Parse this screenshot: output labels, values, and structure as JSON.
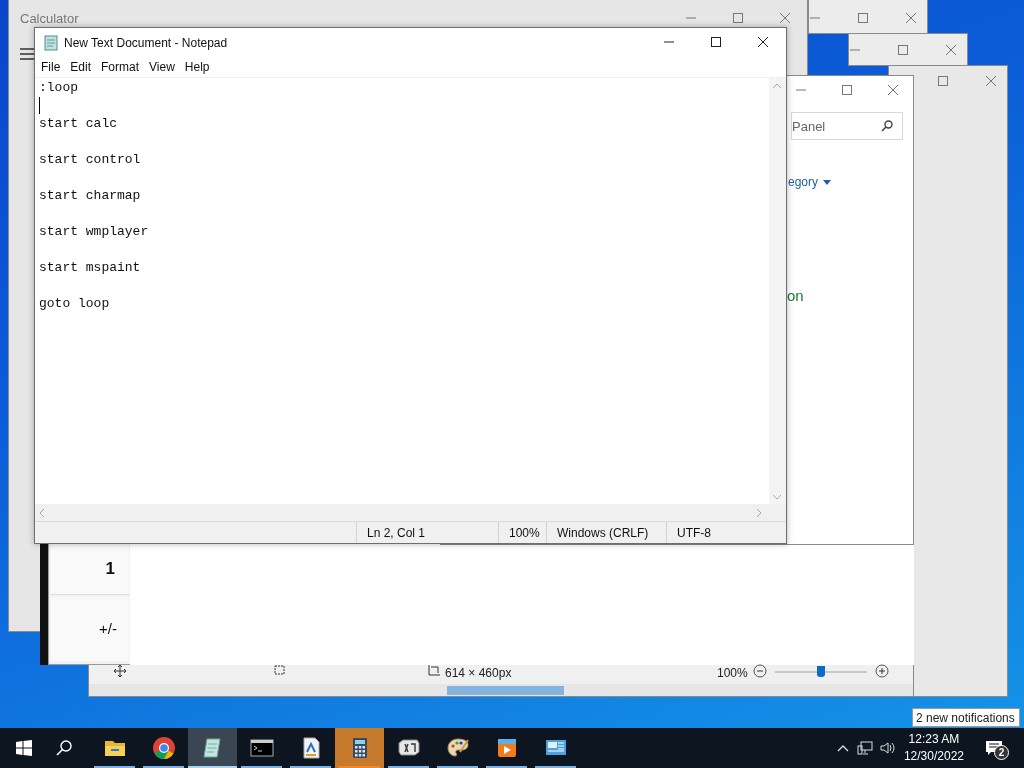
{
  "calculator": {
    "title": "Calculator",
    "keys": [
      "1",
      "+/-"
    ]
  },
  "control_panel": {
    "search": {
      "placeholder": "Panel"
    },
    "view_by": "egory",
    "link": "on"
  },
  "paint": {
    "size": "614 × 460px",
    "zoom": "100%",
    "zoom_slider": {
      "level": 0.5
    }
  },
  "notepad": {
    "title": "New Text Document - Notepad",
    "menu": [
      "File",
      "Edit",
      "Format",
      "View",
      "Help"
    ],
    "lines": [
      {
        "text": ":loop",
        "blank_after": true,
        "caret_below": true
      },
      {
        "text": "start calc",
        "blank_after": true,
        "caret_below": false
      },
      {
        "text": "start control",
        "blank_after": true,
        "caret_below": false
      },
      {
        "text": "start charmap",
        "blank_after": true,
        "caret_below": false
      },
      {
        "text": "start wmplayer",
        "blank_after": true,
        "caret_below": false
      },
      {
        "text": "start mspaint",
        "blank_after": true,
        "caret_below": false
      },
      {
        "text": "goto loop",
        "blank_after": false,
        "caret_below": false
      }
    ],
    "status": [
      "Ln 2, Col 1",
      "100%",
      "Windows (CRLF)",
      "UTF-8"
    ]
  },
  "taskbar": {
    "apps": [
      {
        "kind": "explorer",
        "selected": false,
        "attention": false
      },
      {
        "kind": "chrome",
        "selected": false,
        "attention": false
      },
      {
        "kind": "notepad",
        "selected": true,
        "attention": false
      },
      {
        "kind": "console",
        "selected": false,
        "attention": false
      },
      {
        "kind": "document",
        "selected": false,
        "attention": false
      },
      {
        "kind": "calculator",
        "selected": false,
        "attention": true
      },
      {
        "kind": "charmap",
        "selected": false,
        "attention": false
      },
      {
        "kind": "paint",
        "selected": false,
        "attention": false
      },
      {
        "kind": "player",
        "selected": false,
        "attention": false
      },
      {
        "kind": "panel",
        "selected": false,
        "attention": false
      }
    ],
    "time": "12:23 AM",
    "date": "12/30/2022",
    "notification_count": "2",
    "tooltip": "2 new notifications"
  }
}
